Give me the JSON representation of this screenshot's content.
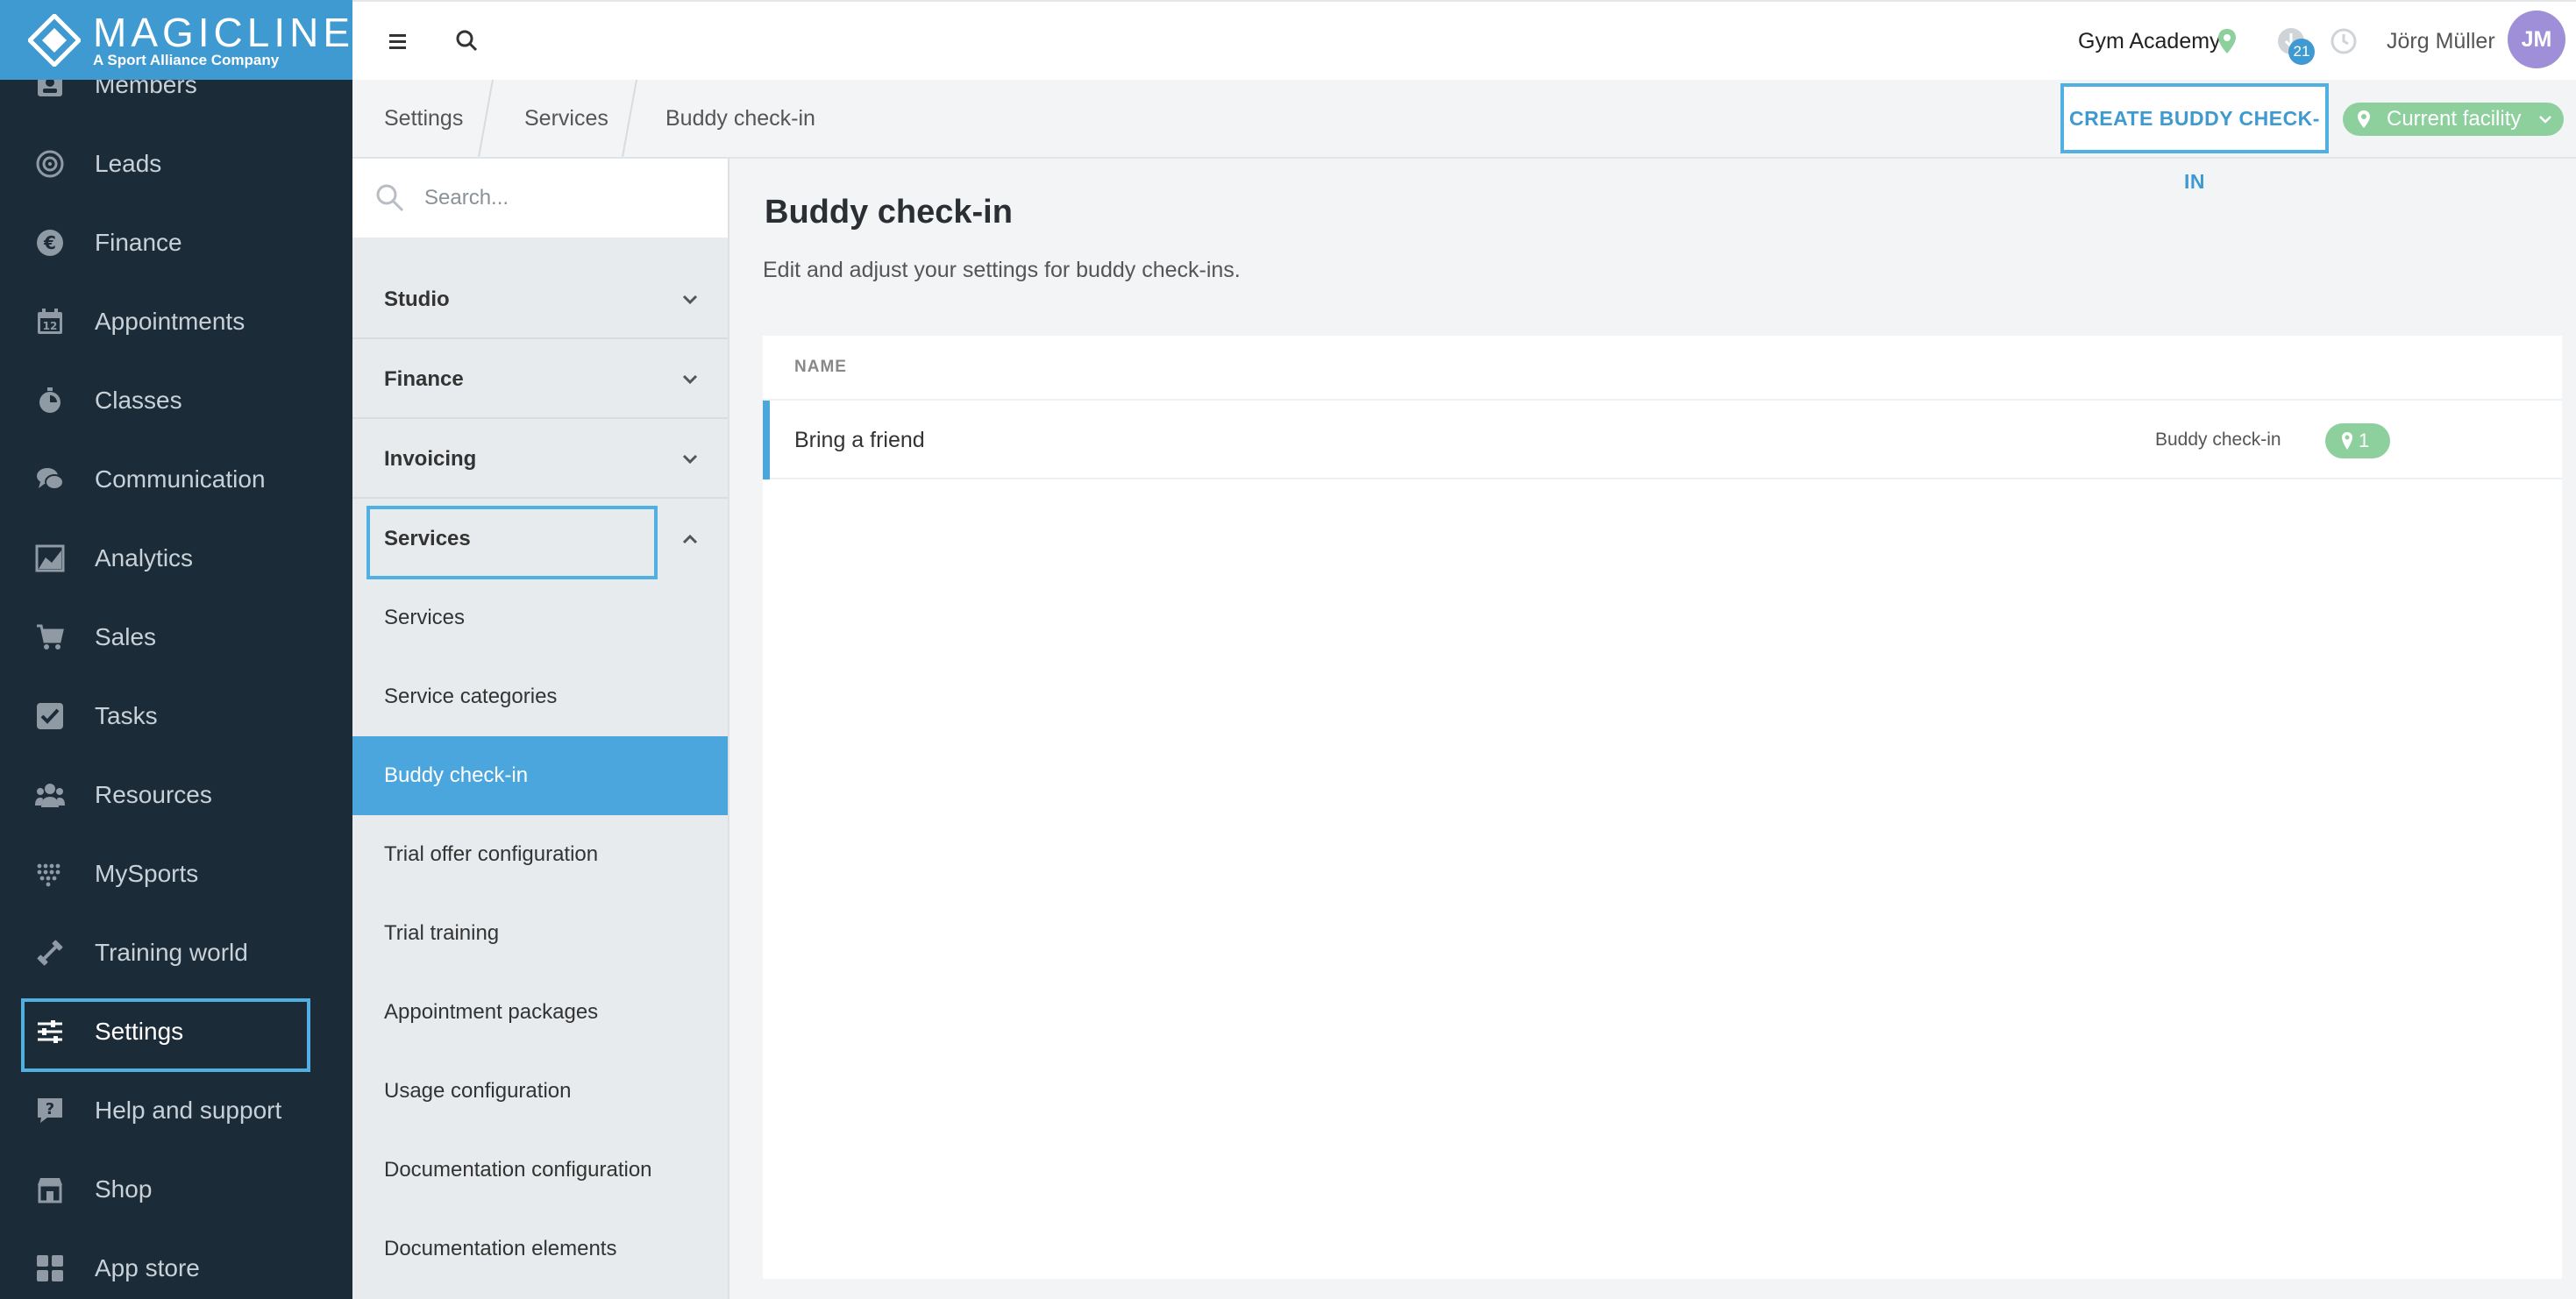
{
  "brand": {
    "name": "MAGICLINE",
    "tagline": "A Sport Alliance Company"
  },
  "sidebar": {
    "items": [
      {
        "label": "Members",
        "icon": "member-card-icon"
      },
      {
        "label": "Leads",
        "icon": "target-icon"
      },
      {
        "label": "Finance",
        "icon": "euro-icon"
      },
      {
        "label": "Appointments",
        "icon": "calendar-icon"
      },
      {
        "label": "Classes",
        "icon": "stopwatch-icon"
      },
      {
        "label": "Communication",
        "icon": "chat-bubbles-icon"
      },
      {
        "label": "Analytics",
        "icon": "chart-area-icon"
      },
      {
        "label": "Sales",
        "icon": "cart-icon"
      },
      {
        "label": "Tasks",
        "icon": "checkbox-icon"
      },
      {
        "label": "Resources",
        "icon": "people-group-icon"
      },
      {
        "label": "MySports",
        "icon": "dots-grid-icon"
      },
      {
        "label": "Training world",
        "icon": "dumbbell-icon"
      },
      {
        "label": "Settings",
        "icon": "sliders-icon",
        "active": true
      },
      {
        "label": "Help and support",
        "icon": "help-icon"
      },
      {
        "label": "Shop",
        "icon": "store-icon"
      },
      {
        "label": "App store",
        "icon": "app-grid-icon"
      }
    ]
  },
  "topbar": {
    "studio": "Gym Academy",
    "notification_count": "21",
    "user_name": "Jörg Müller",
    "user_initials": "JM",
    "colors": {
      "accent": "#3e9ad1",
      "green": "#8dd09e",
      "avatar": "#9e8fd8"
    }
  },
  "breadcrumb": [
    "Settings",
    "Services",
    "Buddy check-in"
  ],
  "actions": {
    "create": "CREATE BUDDY CHECK-IN",
    "facility": "Current facility"
  },
  "subnav": {
    "search_placeholder": "Search...",
    "groups": [
      {
        "label": "Studio",
        "expanded": false
      },
      {
        "label": "Finance",
        "expanded": false
      },
      {
        "label": "Invoicing",
        "expanded": false
      },
      {
        "label": "Services",
        "expanded": true
      }
    ],
    "service_items": [
      {
        "label": "Services"
      },
      {
        "label": "Service categories"
      },
      {
        "label": "Buddy check-in",
        "active": true
      },
      {
        "label": "Trial offer configuration"
      },
      {
        "label": "Trial training"
      },
      {
        "label": "Appointment packages"
      },
      {
        "label": "Usage configuration"
      },
      {
        "label": "Documentation configuration"
      },
      {
        "label": "Documentation elements"
      }
    ]
  },
  "main": {
    "title": "Buddy check-in",
    "description": "Edit and adjust your settings for buddy check-ins.",
    "table": {
      "column_name": "NAME",
      "rows": [
        {
          "name": "Bring a friend",
          "type": "Buddy check-in",
          "facility_count": "1"
        }
      ]
    }
  }
}
